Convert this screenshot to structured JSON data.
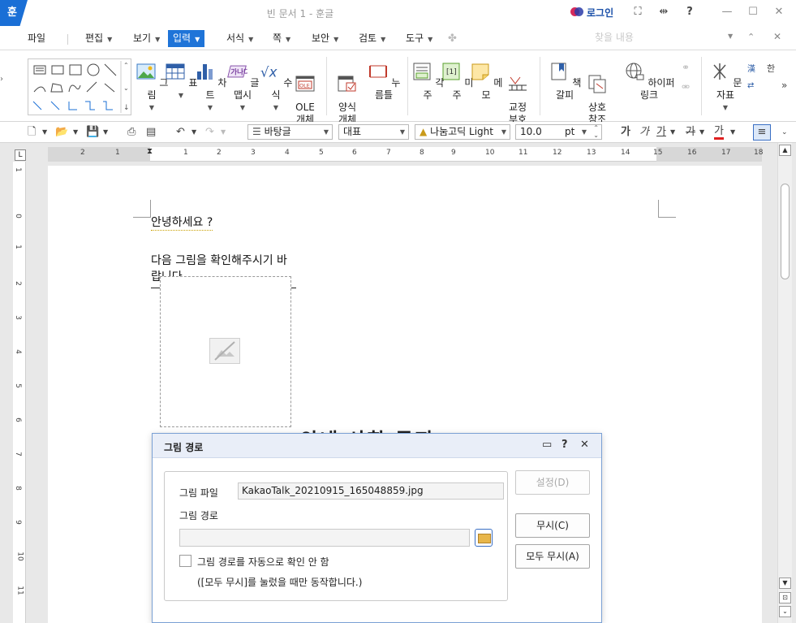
{
  "window": {
    "logo": "훈",
    "title": "빈 문서 1 - 훈글",
    "login": "로그인",
    "buttons": {
      "fullscreen": "⛶",
      "split": "⇹",
      "help": "?",
      "minimize": "—",
      "maximize": "☐",
      "close": "✕"
    }
  },
  "menu": {
    "items": [
      "파일",
      "편집",
      "보기",
      "입력",
      "서식",
      "쪽",
      "보안",
      "검토",
      "도구"
    ],
    "active": "입력",
    "search_placeholder": "찾을 내용"
  },
  "ribbon": {
    "buttons": [
      {
        "label": "그림",
        "icon": "picture-icon"
      },
      {
        "label": "표",
        "icon": "table-icon"
      },
      {
        "label": "차트",
        "icon": "chart-icon"
      },
      {
        "label": "글맵시",
        "icon": "wordart-icon"
      },
      {
        "label": "수식",
        "icon": "formula-icon"
      },
      {
        "label": "OLE\n개체",
        "icon": "ole-icon"
      },
      {
        "label": "양식\n개체",
        "icon": "form-icon"
      },
      {
        "label": "누름틀",
        "icon": "field-icon"
      },
      {
        "label": "각주",
        "icon": "footnote-icon"
      },
      {
        "label": "미주",
        "icon": "endnote-icon"
      },
      {
        "label": "메모",
        "icon": "memo-icon"
      },
      {
        "label": "교정\n부호",
        "icon": "proofread-icon"
      },
      {
        "label": "책갈피",
        "icon": "bookmark-icon"
      },
      {
        "label": "상호\n참조",
        "icon": "crossref-icon"
      },
      {
        "label": "하이퍼링크",
        "icon": "hyperlink-icon"
      },
      {
        "label": "문자표",
        "icon": "symbol-icon"
      }
    ]
  },
  "format": {
    "style": "바탕글",
    "language": "대표",
    "font": "나눔고딕 Light",
    "size": "10.0",
    "unit": "pt",
    "bold_glyph": "가",
    "italic_glyph": "가",
    "underline_glyph": "가",
    "strike_glyph": "가",
    "color_glyph": "가"
  },
  "colors": {
    "accent": "#1f74d8",
    "dialog_border": "#7aa0d4",
    "text_color_mark": "#e01f1f"
  },
  "ruler": {
    "h_ticks": [
      "2",
      "1",
      "1",
      "2",
      "3",
      "4",
      "5",
      "6",
      "7",
      "8",
      "9",
      "10",
      "11",
      "12",
      "13",
      "14",
      "15",
      "16",
      "17",
      "18"
    ],
    "v_ticks": [
      "1",
      "0",
      "1",
      "2",
      "3",
      "4",
      "5",
      "6",
      "7",
      "8",
      "9",
      "10",
      "11"
    ]
  },
  "document": {
    "line1": "안녕하세요 ?",
    "line2": "다음 그림을 확인해주시기 바랍니다",
    "background_heading": "안내 사항 공지"
  },
  "dialog": {
    "title": "그림 경로",
    "file_label": "그림 파일",
    "file_value": "KakaoTalk_20210915_165048859.jpg",
    "path_label": "그림 경로",
    "path_value": "",
    "auto_check_label": "그림 경로를 자동으로 확인 안 함",
    "note": "([모두 무시]를 눌렀을 때만 동작합니다.)",
    "btn_settings": "설정(D)",
    "btn_ignore": "무시(C)",
    "btn_ignore_all": "모두 무시(A)"
  }
}
